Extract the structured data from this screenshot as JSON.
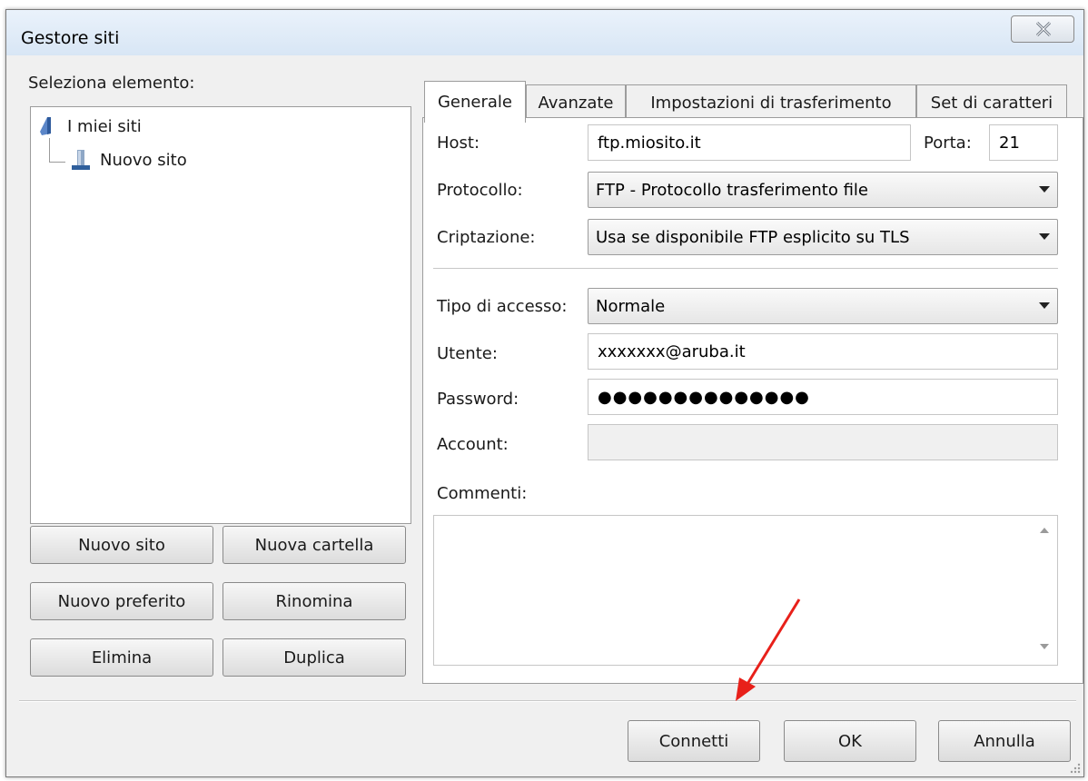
{
  "window": {
    "title": "Gestore siti"
  },
  "left": {
    "select_label": "Seleziona elemento:",
    "tree": {
      "root": "I miei siti",
      "child": "Nuovo sito"
    },
    "buttons": {
      "new_site": "Nuovo sito",
      "new_folder": "Nuova cartella",
      "new_bookmark": "Nuovo preferito",
      "rename": "Rinomina",
      "delete": "Elimina",
      "duplicate": "Duplica"
    }
  },
  "tabs": [
    {
      "label": "Generale",
      "active": true
    },
    {
      "label": "Avanzate",
      "active": false
    },
    {
      "label": "Impostazioni di trasferimento",
      "active": false
    },
    {
      "label": "Set di caratteri",
      "active": false
    }
  ],
  "general": {
    "host_label": "Host:",
    "host_value": "ftp.miosito.it",
    "port_label": "Porta:",
    "port_value": "21",
    "protocol_label": "Protocollo:",
    "protocol_value": "FTP - Protocollo trasferimento file",
    "encryption_label": "Criptazione:",
    "encryption_value": "Usa se disponibile FTP esplicito su TLS",
    "logon_label": "Tipo di accesso:",
    "logon_value": "Normale",
    "user_label": "Utente:",
    "user_value": "xxxxxxx@aruba.it",
    "password_label": "Password:",
    "password_value": "●●●●●●●●●●●●●●",
    "account_label": "Account:",
    "account_value": "",
    "comments_label": "Commenti:",
    "comments_value": ""
  },
  "footer": {
    "connect": "Connetti",
    "ok": "OK",
    "cancel": "Annulla"
  },
  "colors": {
    "annotation_arrow": "#e8201a"
  }
}
